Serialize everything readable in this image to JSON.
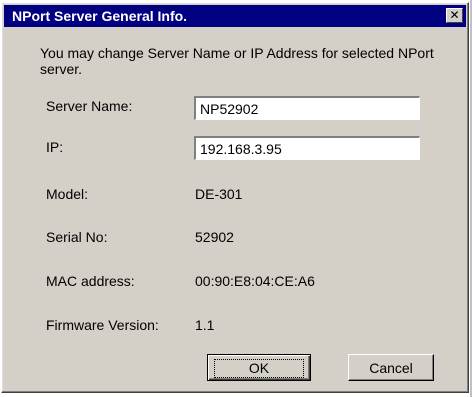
{
  "window": {
    "title": "NPort Server General Info.",
    "close_glyph": "✕"
  },
  "intro_text": "You may change Server Name or IP Address for selected NPort server.",
  "fields": {
    "server_name": {
      "label": "Server Name:",
      "value": "NP52902"
    },
    "ip": {
      "label": "IP:",
      "value": "192.168.3.95"
    }
  },
  "info": {
    "model": {
      "label": "Model:",
      "value": "DE-301"
    },
    "serial": {
      "label": "Serial No:",
      "value": "52902"
    },
    "mac": {
      "label": "MAC address:",
      "value": "00:90:E8:04:CE:A6"
    },
    "firmware": {
      "label": "Firmware Version:",
      "value": "1.1"
    }
  },
  "buttons": {
    "ok_label": "OK",
    "cancel_label": "Cancel"
  },
  "colors": {
    "titlebar": "#000080",
    "dialog_face": "#d4d0c8"
  }
}
